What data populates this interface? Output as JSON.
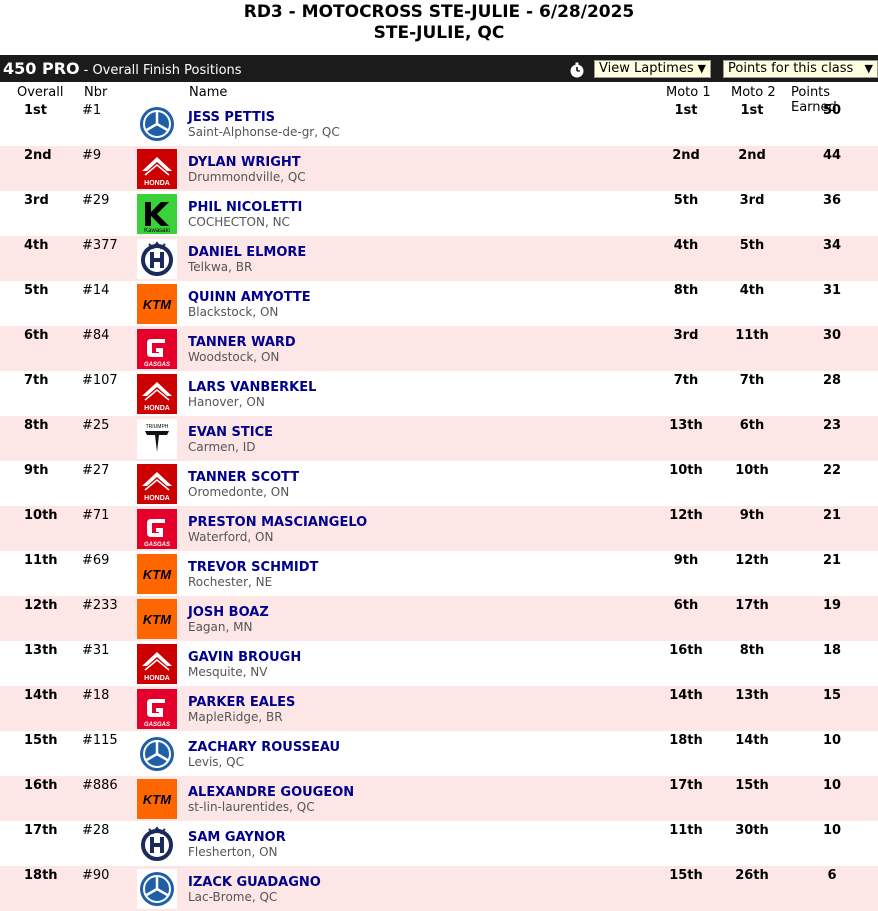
{
  "event": {
    "title_line1": "RD3 - MOTOCROSS STE-JULIE  - 6/28/2025",
    "title_line2": "STE-JULIE, QC"
  },
  "class_bar": {
    "class_name": "450 PRO",
    "subtitle": "- Overall Finish Positions",
    "view_laptimes": "View Laptimes",
    "points_select": "Points for this class"
  },
  "columns": {
    "overall": "Overall",
    "nbr": "Nbr",
    "name": "Name",
    "moto1": "Moto 1",
    "moto2": "Moto 2",
    "points": "Points Earned"
  },
  "rows": [
    {
      "pos": "1st",
      "nbr": "#1",
      "name": "JESS PETTIS",
      "city": "Saint-Alphonse-de-gr, QC",
      "m1": "1st",
      "m2": "1st",
      "pts": "50",
      "brand": "yamaha-logo"
    },
    {
      "pos": "2nd",
      "nbr": "#9",
      "name": "DYLAN WRIGHT",
      "city": "Drummondville, QC",
      "m1": "2nd",
      "m2": "2nd",
      "pts": "44",
      "brand": "honda-logo"
    },
    {
      "pos": "3rd",
      "nbr": "#29",
      "name": "PHIL NICOLETTI",
      "city": "COCHECTON, NC",
      "m1": "5th",
      "m2": "3rd",
      "pts": "36",
      "brand": "kawasaki-logo"
    },
    {
      "pos": "4th",
      "nbr": "#377",
      "name": "DANIEL ELMORE",
      "city": "Telkwa, BR",
      "m1": "4th",
      "m2": "5th",
      "pts": "34",
      "brand": "husqvarna-logo"
    },
    {
      "pos": "5th",
      "nbr": "#14",
      "name": "QUINN AMYOTTE",
      "city": "Blackstock, ON",
      "m1": "8th",
      "m2": "4th",
      "pts": "31",
      "brand": "ktm-logo"
    },
    {
      "pos": "6th",
      "nbr": "#84",
      "name": "TANNER WARD",
      "city": "Woodstock, ON",
      "m1": "3rd",
      "m2": "11th",
      "pts": "30",
      "brand": "gasgas-logo"
    },
    {
      "pos": "7th",
      "nbr": "#107",
      "name": "LARS VANBERKEL",
      "city": "Hanover, ON",
      "m1": "7th",
      "m2": "7th",
      "pts": "28",
      "brand": "honda-logo"
    },
    {
      "pos": "8th",
      "nbr": "#25",
      "name": "EVAN STICE",
      "city": "Carmen, ID",
      "m1": "13th",
      "m2": "6th",
      "pts": "23",
      "brand": "triumph-logo"
    },
    {
      "pos": "9th",
      "nbr": "#27",
      "name": "TANNER SCOTT",
      "city": "Oromedonte, ON",
      "m1": "10th",
      "m2": "10th",
      "pts": "22",
      "brand": "honda-logo"
    },
    {
      "pos": "10th",
      "nbr": "#71",
      "name": "PRESTON MASCIANGELO",
      "city": "Waterford, ON",
      "m1": "12th",
      "m2": "9th",
      "pts": "21",
      "brand": "gasgas-logo"
    },
    {
      "pos": "11th",
      "nbr": "#69",
      "name": "TREVOR SCHMIDT",
      "city": "Rochester, NE",
      "m1": "9th",
      "m2": "12th",
      "pts": "21",
      "brand": "ktm-logo"
    },
    {
      "pos": "12th",
      "nbr": "#233",
      "name": "JOSH BOAZ",
      "city": "Eagan, MN",
      "m1": "6th",
      "m2": "17th",
      "pts": "19",
      "brand": "ktm-logo"
    },
    {
      "pos": "13th",
      "nbr": "#31",
      "name": "GAVIN BROUGH",
      "city": "Mesquite, NV",
      "m1": "16th",
      "m2": "8th",
      "pts": "18",
      "brand": "honda-logo"
    },
    {
      "pos": "14th",
      "nbr": "#18",
      "name": "PARKER EALES",
      "city": "MapleRidge, BR",
      "m1": "14th",
      "m2": "13th",
      "pts": "15",
      "brand": "gasgas-logo"
    },
    {
      "pos": "15th",
      "nbr": "#115",
      "name": "ZACHARY ROUSSEAU",
      "city": "Levis, QC",
      "m1": "18th",
      "m2": "14th",
      "pts": "10",
      "brand": "yamaha-logo"
    },
    {
      "pos": "16th",
      "nbr": "#886",
      "name": "ALEXANDRE GOUGEON",
      "city": "st-lin-laurentides, QC",
      "m1": "17th",
      "m2": "15th",
      "pts": "10",
      "brand": "ktm-logo"
    },
    {
      "pos": "17th",
      "nbr": "#28",
      "name": "SAM GAYNOR",
      "city": "Flesherton, ON",
      "m1": "11th",
      "m2": "30th",
      "pts": "10",
      "brand": "husqvarna-logo"
    },
    {
      "pos": "18th",
      "nbr": "#90",
      "name": "IZACK GUADAGNO",
      "city": "Lac-Brome, QC",
      "m1": "15th",
      "m2": "26th",
      "pts": "6",
      "brand": "yamaha-logo"
    }
  ],
  "brand_text": {
    "honda": "HONDA",
    "kawasaki": "Kawasaki",
    "ktm": "KTM",
    "gasgas": "GASGAS",
    "triumph": "TRIUMPH"
  },
  "colors": {
    "header_bar": "#1b1b1b",
    "row_alt": "#fde6e6",
    "rider_name": "#00008b",
    "select_bg": "#ffffe0"
  }
}
